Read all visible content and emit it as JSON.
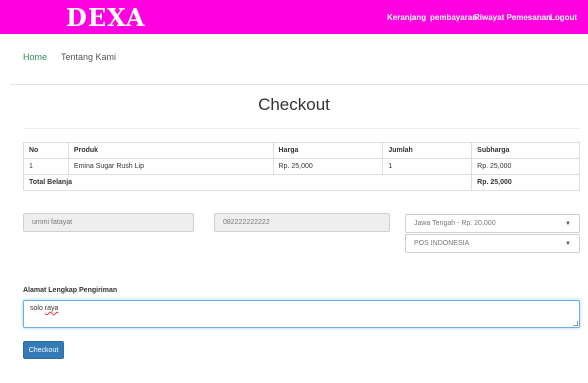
{
  "navbar": {
    "brand": "DEXA",
    "links": [
      "Keranjang",
      "pembayaran",
      "Riwayat Pemesanan",
      "Logout"
    ]
  },
  "subnav": {
    "links": [
      "Home",
      "Tentang Kami"
    ]
  },
  "page_title": "Checkout",
  "table": {
    "headers": [
      "No",
      "Produk",
      "Harga",
      "Jumlah",
      "Subharga"
    ],
    "rows": [
      {
        "no": "1",
        "produk": "Emina Sugar Rush Lip",
        "harga": "Rp. 25,000",
        "jumlah": "1",
        "subharga": "Rp. 25,000"
      }
    ],
    "total_label": "Total Belanja",
    "total_value": "Rp. 25,000"
  },
  "form": {
    "nama": "ummi fatayat",
    "telepon": "082222222222",
    "ongkir_selected": "Jawa Tengah - Rp. 20,000",
    "ekspedisi_selected": "POS INDONESIA",
    "alamat_label": "Alamat Lengkap Pengiriman",
    "alamat_word1": "solo",
    "alamat_word2": "raya",
    "submit_label": "Checkout"
  },
  "colors": {
    "navbar_bg": "#ff00e1",
    "button_bg": "#337ab7",
    "home_link": "#2e8b57"
  }
}
